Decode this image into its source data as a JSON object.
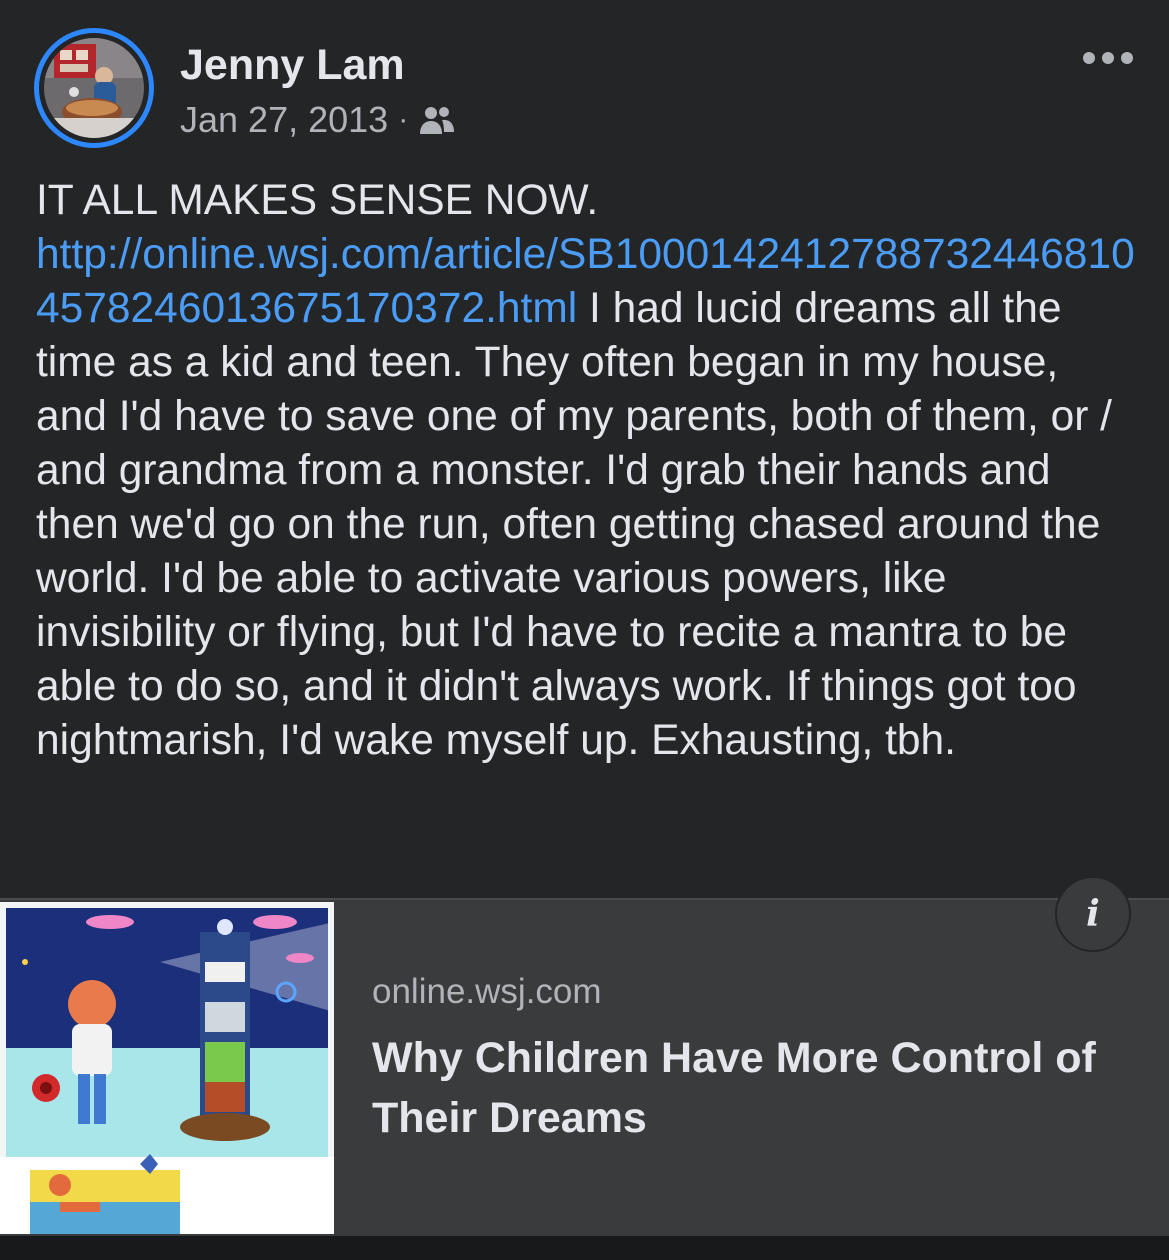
{
  "post": {
    "author": "Jenny Lam",
    "date": "Jan 27, 2013",
    "separator": "·",
    "audience_icon": "friends-icon",
    "more_icon": "more-horizontal-icon",
    "text_before_link": "IT ALL MAKES SENSE NOW. ",
    "link": "http://online.wsj.com/article/SB10001424127887324468104578246013675170372.html",
    "text_after_link": " I had lucid dreams all the time as a kid and teen. They often began in my house, and I'd have to save one of my parents, both of them, or / and grandma from a monster. I'd grab their hands and then we'd go on the run, often getting chased around the world. I'd be able to activate various powers, like invisibility or flying, but I'd have to recite a mantra to be able to do so, and it didn't always work. If things got too nightmarish, I'd wake myself up. Exhausting, tbh."
  },
  "link_preview": {
    "domain": "online.wsj.com",
    "title": "Why Children Have More Control of Their Dreams",
    "info_icon": "info-icon",
    "info_label": "i"
  },
  "colors": {
    "background": "#242526",
    "card": "#3a3b3c",
    "link": "#4b9cf5",
    "avatar_ring": "#2d88ff",
    "text_primary": "#e4e6eb",
    "text_secondary": "#b0b3b8"
  }
}
